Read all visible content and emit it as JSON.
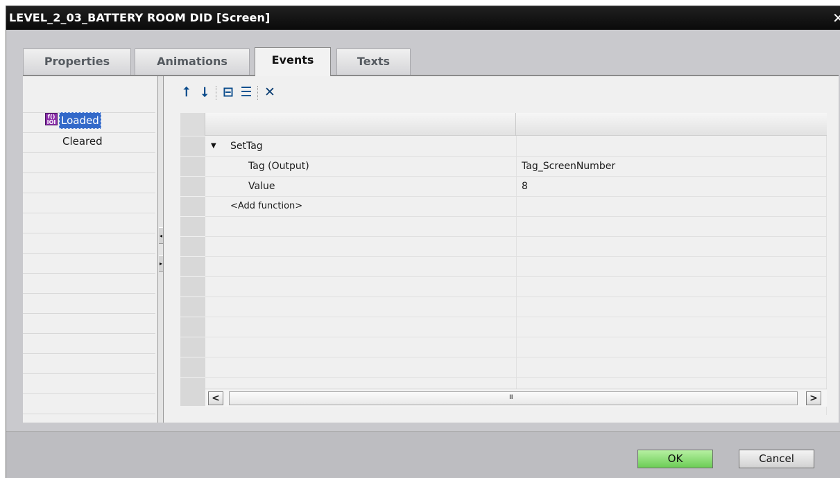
{
  "window": {
    "title": "LEVEL_2_03_BATTERY ROOM DID [Screen]",
    "close_glyph": "✕"
  },
  "tabs": [
    {
      "label": "Properties",
      "active": false
    },
    {
      "label": "Animations",
      "active": false
    },
    {
      "label": "Events",
      "active": true
    },
    {
      "label": "Texts",
      "active": false
    }
  ],
  "events": {
    "items": [
      {
        "label": "Loaded",
        "selected": true,
        "icon": "function-list-icon"
      },
      {
        "label": "Cleared",
        "selected": false
      }
    ]
  },
  "toolbar": {
    "move_up_glyph": "⭡",
    "move_down_glyph": "⭣",
    "collapse_glyph": "⊟",
    "expand_glyph": "☰",
    "delete_glyph": "✕"
  },
  "function_list": {
    "rows": [
      {
        "name": "SetTag",
        "value": "",
        "expandable": true
      },
      {
        "name": "Tag (Output)",
        "value": "Tag_ScreenNumber"
      },
      {
        "name": "Value",
        "value": "8"
      },
      {
        "name": "<Add function>",
        "value": ""
      }
    ]
  },
  "scrollbar": {
    "left_glyph": "<",
    "right_glyph": ">",
    "grip_glyph": "III"
  },
  "buttons": {
    "ok": "OK",
    "cancel": "Cancel"
  }
}
